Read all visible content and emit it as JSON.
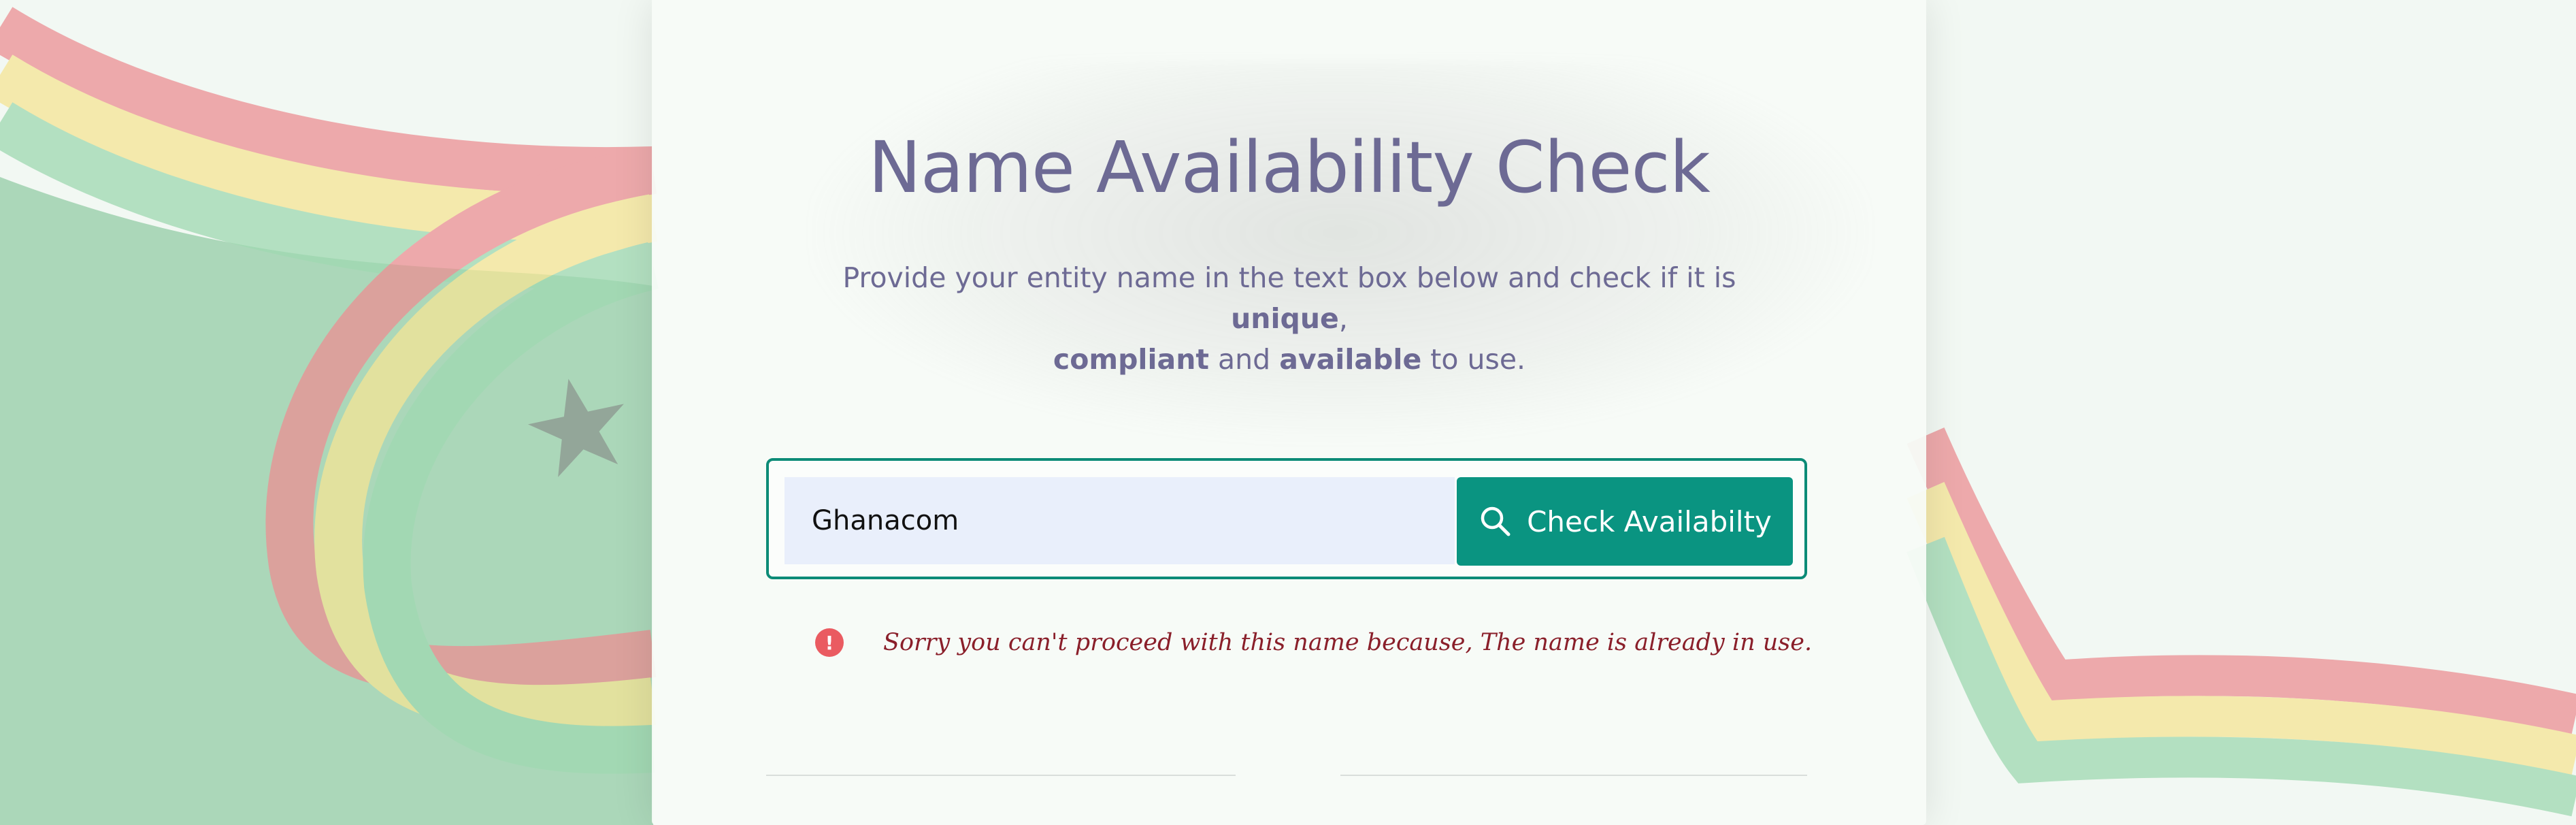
{
  "page": {
    "title": "Name Availability Check",
    "subtitle_parts": {
      "intro": "Provide your entity name in the text box below and check if it is ",
      "unique": "unique",
      "comma": ",",
      "compliant": "compliant",
      "and": " and ",
      "available": "available",
      "outro": " to use."
    }
  },
  "search": {
    "value": "Ghanacom",
    "placeholder": "",
    "button_label": "Check Availabilty",
    "button_icon": "search-icon"
  },
  "error": {
    "icon": "exclamation-circle-icon",
    "message": "Sorry you can't proceed with this name because, The name is already in use."
  },
  "colors": {
    "accent": "#0a9481",
    "title": "#6d6a94",
    "error": "#8a1f2a",
    "error_icon": "#ea5b61",
    "input_bg": "#e9effb"
  },
  "background": {
    "image": "ghana-flag-ribbon",
    "flag_colors": [
      "#e0605f",
      "#f2d34a",
      "#3fa567"
    ]
  }
}
